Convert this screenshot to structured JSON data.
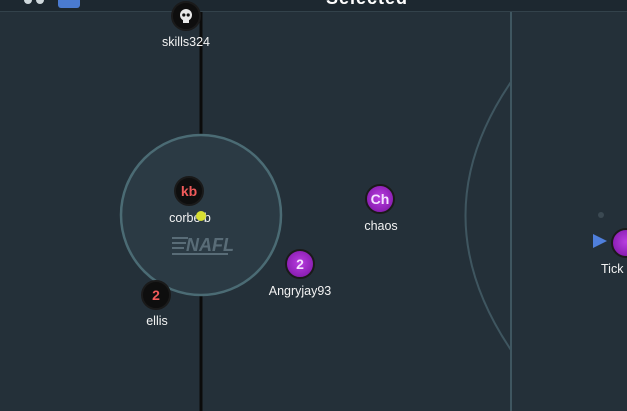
{
  "topbar": {
    "title": "Selected",
    "colors": {
      "bar": "#1d2830",
      "accent": "#4a7bd0"
    }
  },
  "field": {
    "logo_text": "NAFL",
    "colors": {
      "pitch": "#243039",
      "line": "#3f5660",
      "center_line": "#0b0b0b"
    }
  },
  "players": [
    {
      "id": "skills324",
      "name": "skills324",
      "initials": "",
      "icon": "skull-icon",
      "team": "black"
    },
    {
      "id": "corbett",
      "name": "corbe  b",
      "initials": "kb",
      "icon": "",
      "team": "black"
    },
    {
      "id": "ellis",
      "name": "ellis",
      "initials": "2",
      "icon": "",
      "team": "black"
    },
    {
      "id": "chaos",
      "name": "chaos",
      "initials": "Ch",
      "icon": "",
      "team": "purple"
    },
    {
      "id": "angryjay93",
      "name": "Angryjay93",
      "initials": "2",
      "icon": "",
      "team": "purple"
    },
    {
      "id": "tick",
      "name": "Tick",
      "initials": "",
      "icon": "",
      "team": "purple"
    }
  ],
  "ball": {
    "color": "#d7df32"
  },
  "arrow": {
    "icon": "play-arrow-icon",
    "color": "#4f7fdc"
  }
}
